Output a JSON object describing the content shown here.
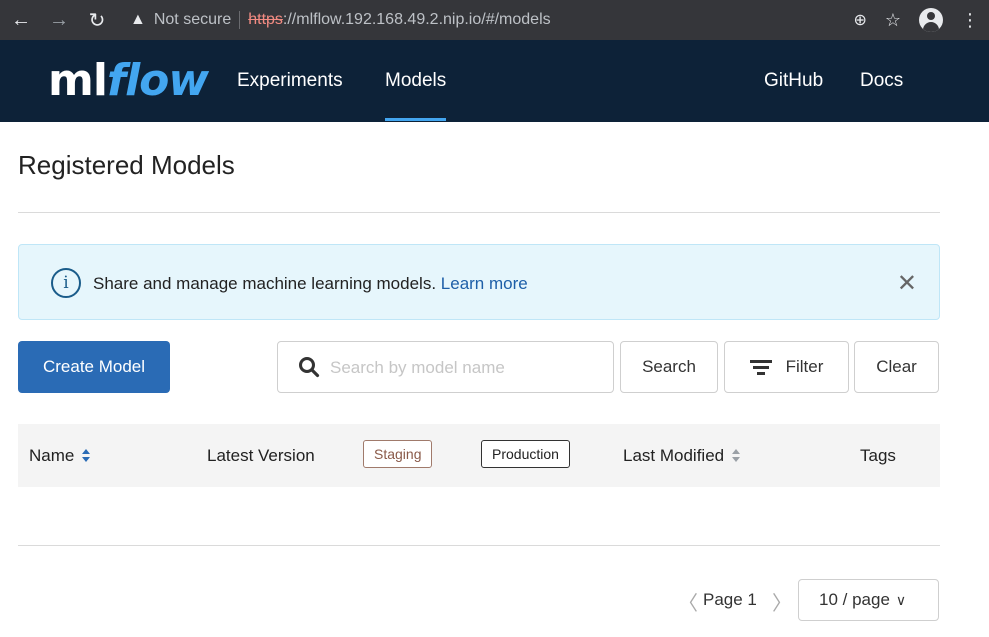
{
  "browser": {
    "not_secure_label": "Not secure",
    "url_scheme": "https",
    "url_rest": "://mlflow.192.168.49.2.nip.io/#/models"
  },
  "header": {
    "logo_ml": "ml",
    "logo_flow": "flow",
    "nav": {
      "experiments": "Experiments",
      "models": "Models",
      "github": "GitHub",
      "docs": "Docs"
    }
  },
  "page": {
    "title": "Registered Models"
  },
  "banner": {
    "message": "Share and manage machine learning models. ",
    "link": "Learn more"
  },
  "toolbar": {
    "create_label": "Create Model",
    "search_placeholder": "Search by model name",
    "search_label": "Search",
    "filter_label": "Filter",
    "clear_label": "Clear"
  },
  "table": {
    "columns": {
      "name": "Name",
      "latest_version": "Latest Version",
      "staging": "Staging",
      "production": "Production",
      "last_modified": "Last Modified",
      "tags": "Tags"
    },
    "rows": []
  },
  "pagination": {
    "page_label": "Page 1",
    "page_size": "10 / page"
  },
  "colors": {
    "header_bg": "#0d2238",
    "accent": "#43a6f0",
    "primary_button": "#2a6bb5",
    "banner_bg": "#e6f6fc"
  }
}
